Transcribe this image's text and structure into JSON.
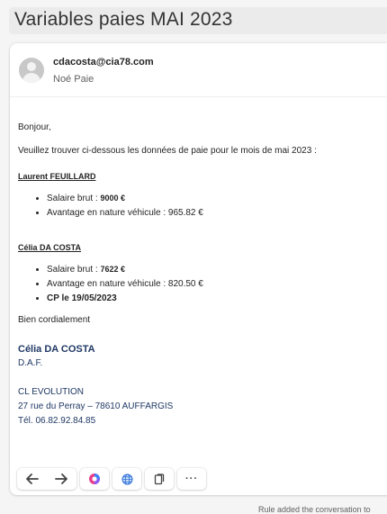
{
  "subject": "Variables paies MAI 2023",
  "sender": {
    "email": "cdacosta@cia78.com",
    "name": "Noé Paie"
  },
  "body": {
    "greeting": "Bonjour,",
    "intro": "Veuillez trouver ci-dessous les données de paie pour le mois de mai 2023 :",
    "employees": [
      {
        "name": "Laurent FEUILLARD",
        "salary_label": "Salaire brut : ",
        "salary_value": "9000 €",
        "benefit": "Avantage en nature véhicule : 965.82 €"
      },
      {
        "name": "Célia DA COSTA",
        "salary_label": "Salaire brut : ",
        "salary_value": "7622 €",
        "benefit": "Avantage en nature véhicule : 820.50 €",
        "extra": "CP le 19/05/2023"
      }
    ],
    "closing": "Bien cordialement"
  },
  "signature": {
    "name": "Célia DA COSTA",
    "title": "D.A.F.",
    "company": "CL EVOLUTION",
    "address": "27 rue du Perray – 78610 AUFFARGIS",
    "phone": "Tél. 06.82.92.84.85"
  },
  "toolbar": {
    "buttons": [
      "reply-icon",
      "forward-icon",
      "copilot-icon",
      "translate-icon",
      "immersive-reader-icon",
      "more-icon"
    ],
    "more_label": "···"
  },
  "footer_note": "Rule added the conversation to"
}
